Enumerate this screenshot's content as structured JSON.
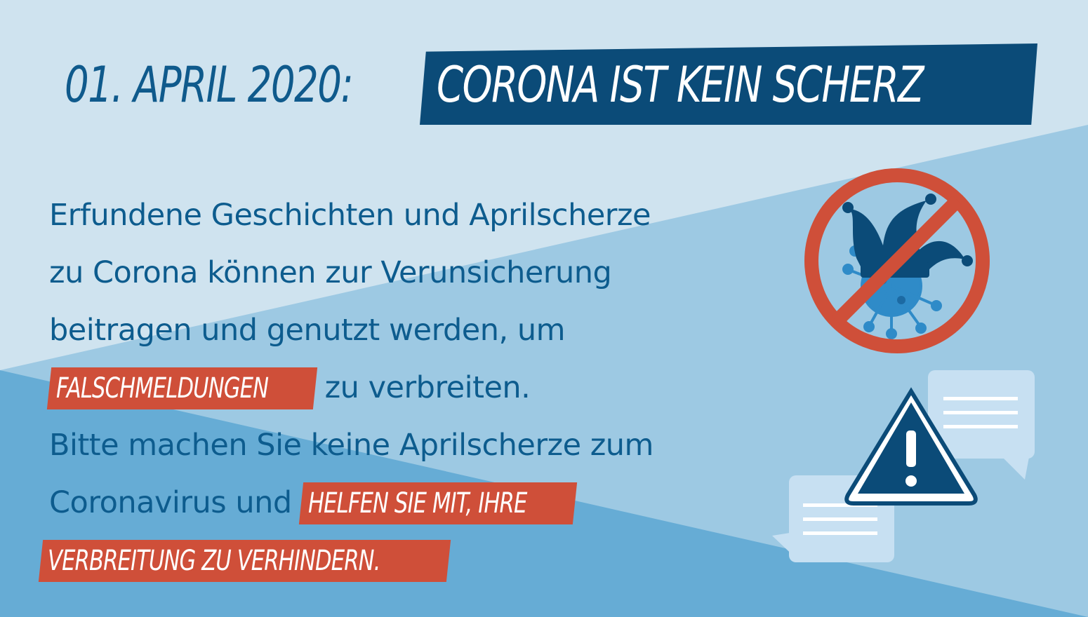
{
  "headline": {
    "date": "01. APRIL 2020:",
    "title": "CORONA IST KEIN SCHERZ"
  },
  "body": {
    "line1": "Erfundene Geschichten und Aprilscherze",
    "line2": "zu Corona können zur Verunsicherung",
    "line3": "beitragen und genutzt werden, um",
    "highlight1": "FALSCHMELDUNGEN",
    "line4_rest": "zu verbreiten.",
    "line5": "Bitte machen Sie keine Aprilscherze zum",
    "line6_start": "Coronavirus und",
    "highlight2": "HELFEN SIE MIT, IHRE",
    "highlight3": "VERBREITUNG ZU VERHINDERN."
  },
  "icons": {
    "prohibited": "no-jester-virus-icon",
    "warning": "warning-triangle-icon",
    "chat": "chat-bubbles-icon"
  },
  "colors": {
    "dark_blue": "#0b4b78",
    "text_blue": "#0d5c8e",
    "accent_red": "#cf4f39",
    "bg_light": "#cfe3ef",
    "bg_mid": "#9cc8e3",
    "bg_dark": "#6aaed6"
  }
}
